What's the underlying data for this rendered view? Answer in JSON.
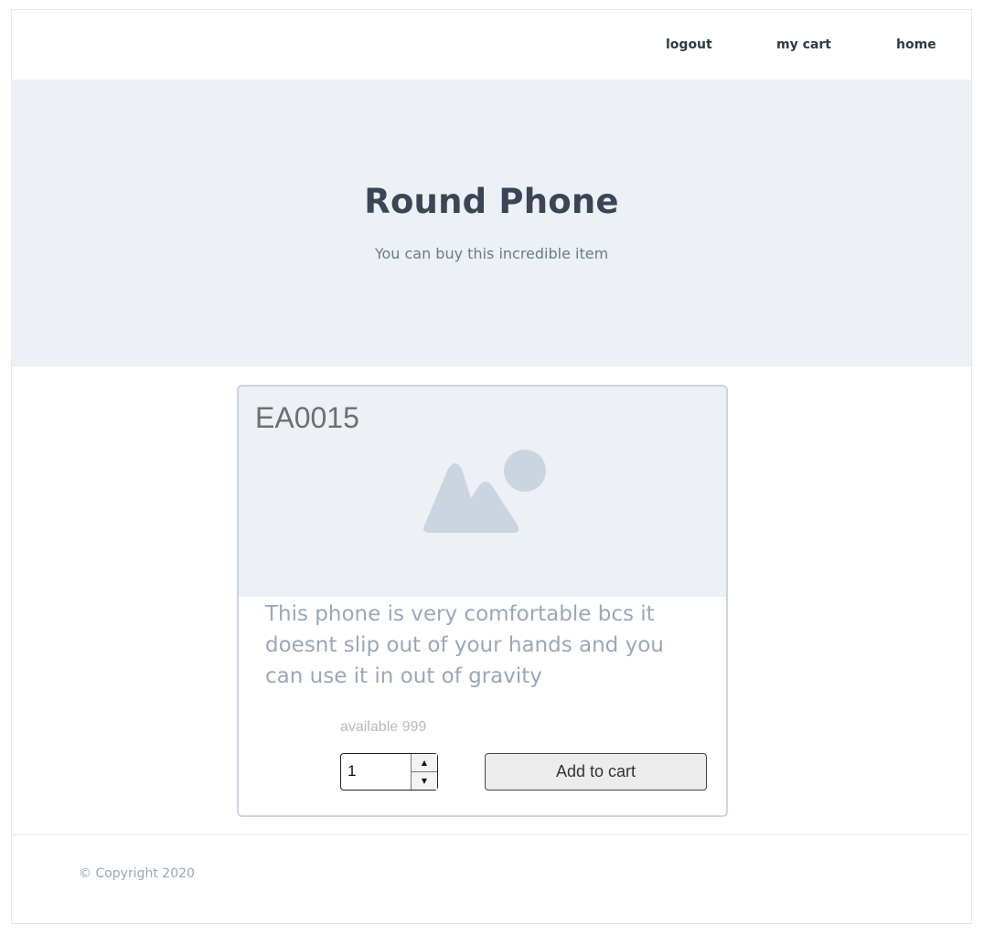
{
  "nav": {
    "logout": "logout",
    "cart": "my cart",
    "home": "home"
  },
  "hero": {
    "title": "Round Phone",
    "subtitle": "You can buy this incredible item"
  },
  "product": {
    "code": "EA0015",
    "image_icon": "image-placeholder-icon",
    "description": "This phone is very comfortable bcs it doesnt slip out of your hands and you can use it in out of gravity",
    "availability": "available 999",
    "quantity": "1",
    "add_to_cart_label": "Add to cart"
  },
  "footer": {
    "copyright": "© Copyright 2020"
  },
  "colors": {
    "hero_bg": "#edf0f4",
    "card_border": "#cbd5df",
    "placeholder_icon": "#cbd5df",
    "title_text": "#3b4556",
    "muted_text": "#9aa7b7"
  }
}
